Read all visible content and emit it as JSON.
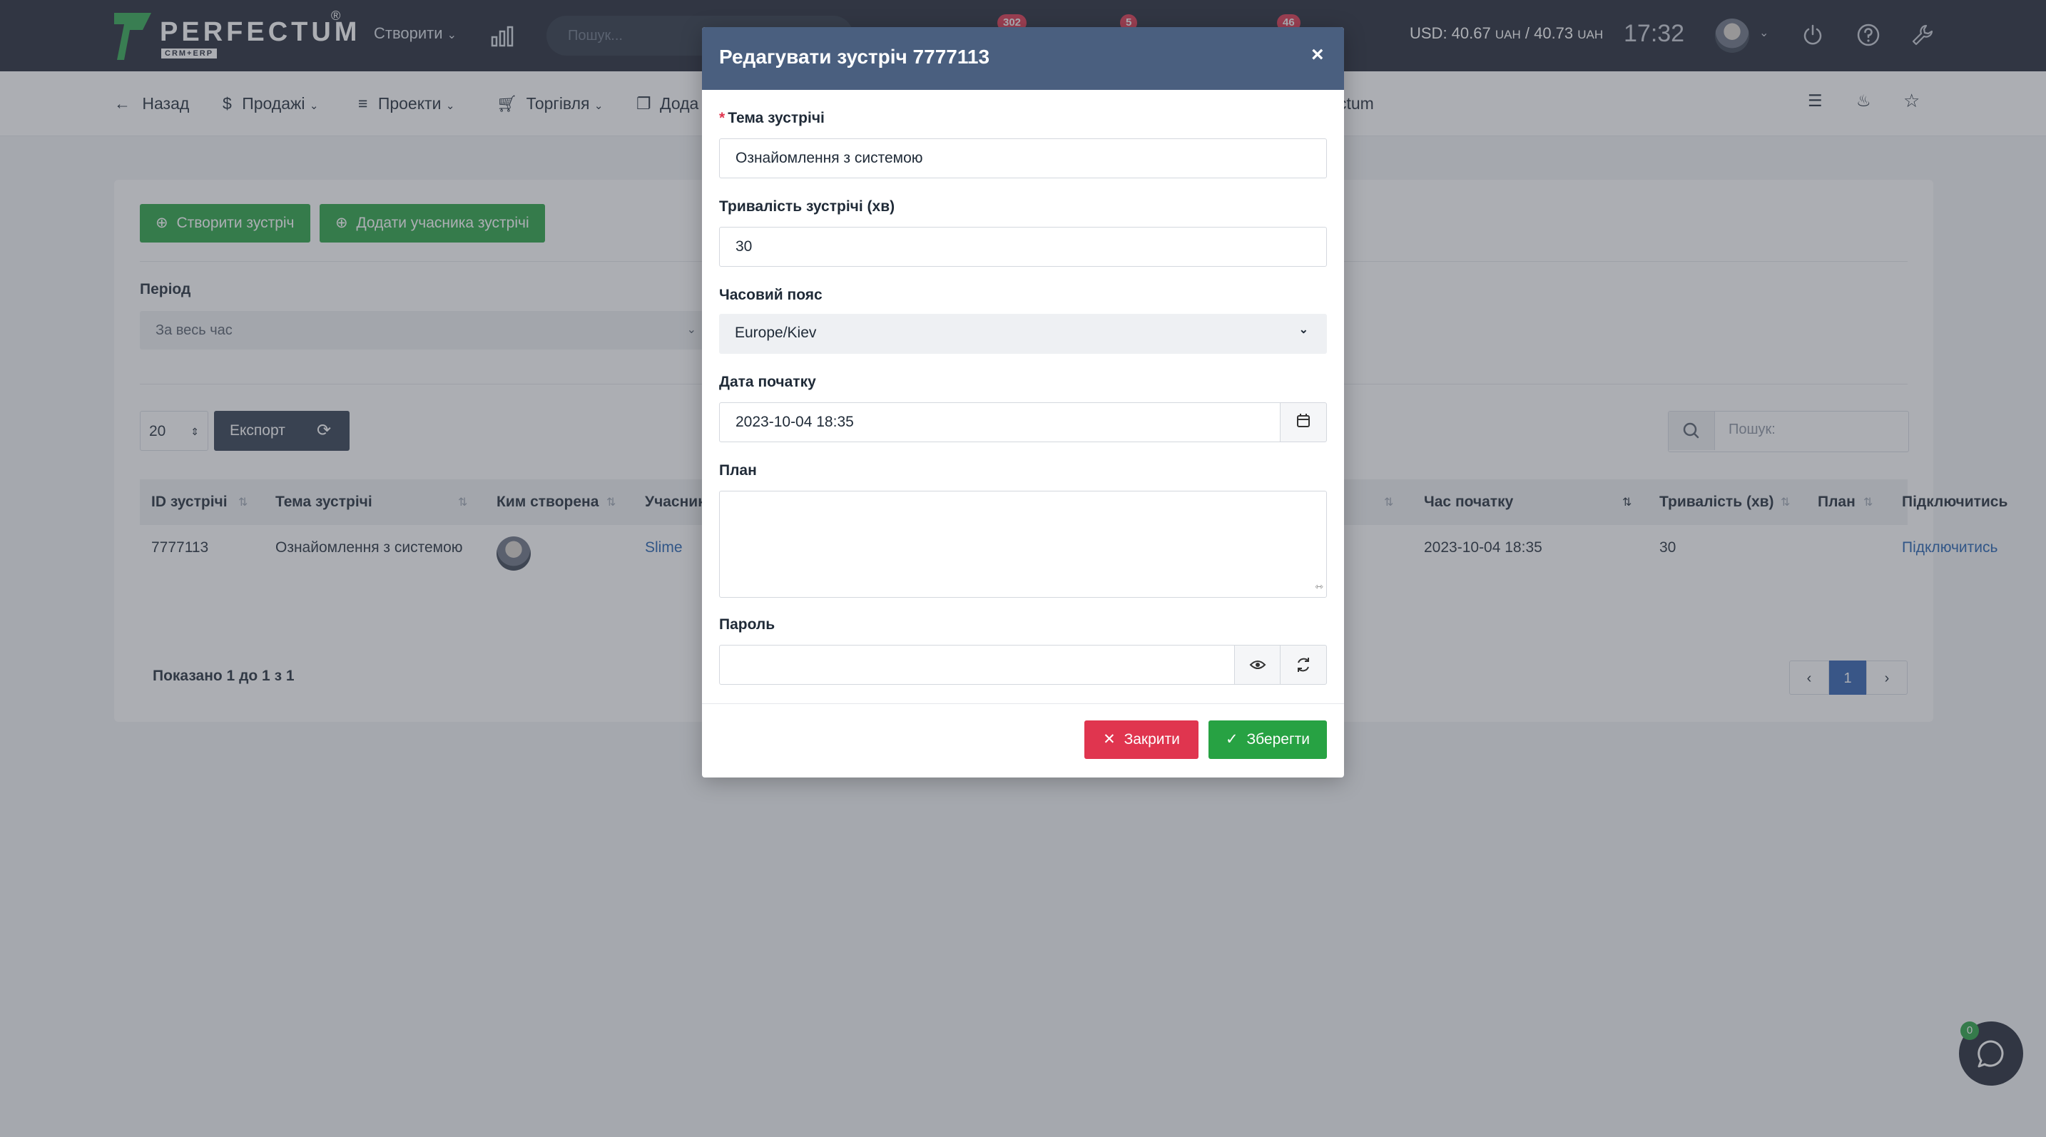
{
  "topbar": {
    "brand": "PERFECTUM",
    "brand_sub": "CRM+ERP",
    "brand_reg": "®",
    "create_label": "Створити",
    "search_placeholder": "Пошук...",
    "badges": [
      "302",
      "5",
      "46"
    ],
    "currency_prefix": "USD: 40.67",
    "currency_unit1": "UAH",
    "currency_mid": " / 40.73",
    "currency_unit2": "UAH",
    "clock": "17:32"
  },
  "subnav": {
    "back": "Назад",
    "sales": "Продажі",
    "projects": "Проекти",
    "trade": "Торгівля",
    "add_partial": "Дода",
    "partial_right": "ctum"
  },
  "page": {
    "create_meeting": "Створити зустріч",
    "add_participant": "Додати учасника зустрічі",
    "period_label": "Період",
    "period_value": "За весь час",
    "page_length": "20",
    "export": "Експорт",
    "search_placeholder": "Пошук:",
    "columns": {
      "id": "ID зустрічі",
      "topic": "Тема зустрічі",
      "created_by": "Ким створена",
      "participants": "Учасник",
      "start_time": "Час початку",
      "duration": "Тривалість (хв)",
      "plan": "План",
      "connect": "Підключитись"
    },
    "row": {
      "id": "7777113",
      "topic": "Ознайомлення з системою",
      "participant": "Slime",
      "start_time": "2023-10-04 18:35",
      "duration": "30",
      "connect": "Підключитись"
    },
    "info": "Показано 1 до 1 з 1",
    "current_page": "1"
  },
  "chat": {
    "count": "0"
  },
  "modal": {
    "title": "Редагувати зустріч 7777113",
    "close_glyph": "×",
    "topic_label": "Тема зустрічі",
    "topic_value": "Ознайомлення з системою",
    "duration_label": "Тривалість зустрічі (хв)",
    "duration_value": "30",
    "timezone_label": "Часовий пояс",
    "timezone_value": "Europe/Kiev",
    "start_label": "Дата початку",
    "start_value": "2023-10-04 18:35",
    "plan_label": "План",
    "plan_value": "",
    "password_label": "Пароль",
    "password_value": "",
    "close_button": "Закрити",
    "save_button": "Зберегти"
  },
  "colors": {
    "accent_green": "#27a243",
    "danger_red": "#e0354f",
    "modal_header": "#4a5f7f",
    "topbar": "#1f2633",
    "link_blue": "#1f5fb0"
  }
}
